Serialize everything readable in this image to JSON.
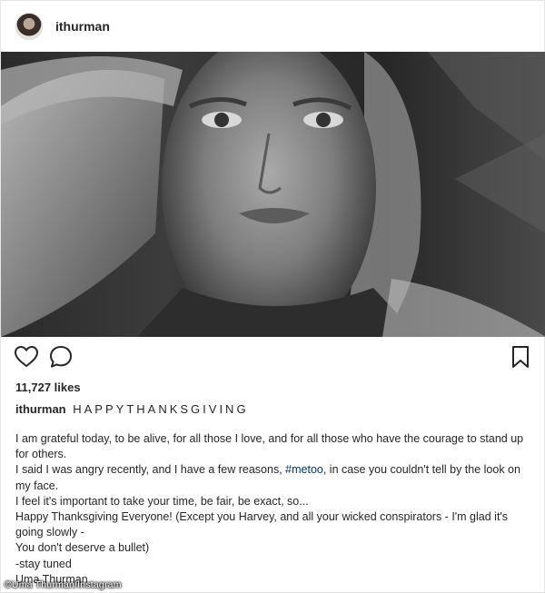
{
  "post": {
    "username": "ithurman",
    "likes": "11,727 likes",
    "caption_user": "ithurman",
    "caption_title": "HAPPYTHANKSGIVING",
    "lines": [
      "I am grateful today, to be alive, for all those I love, and for all those who have the courage to stand up for others.",
      "I said I was angry recently, and I have a few reasons, ",
      "#metoo",
      ", in case you couldn't tell by the look on my face.",
      "I feel it's important to take your time, be fair, be exact, so...",
      "Happy Thanksgiving Everyone! (Except you Harvey, and all your wicked conspirators - I'm glad it's going slowly -",
      "You don't deserve a bullet)",
      "-stay tuned",
      "Uma Thurman"
    ]
  },
  "icons": {
    "like": "heart-icon",
    "comment": "comment-icon",
    "save": "bookmark-icon"
  },
  "watermark": "©Uma Thurman/Instagram",
  "colors": {
    "text": "#262626",
    "hashtag": "#003569",
    "border": "#e6e6e6"
  }
}
